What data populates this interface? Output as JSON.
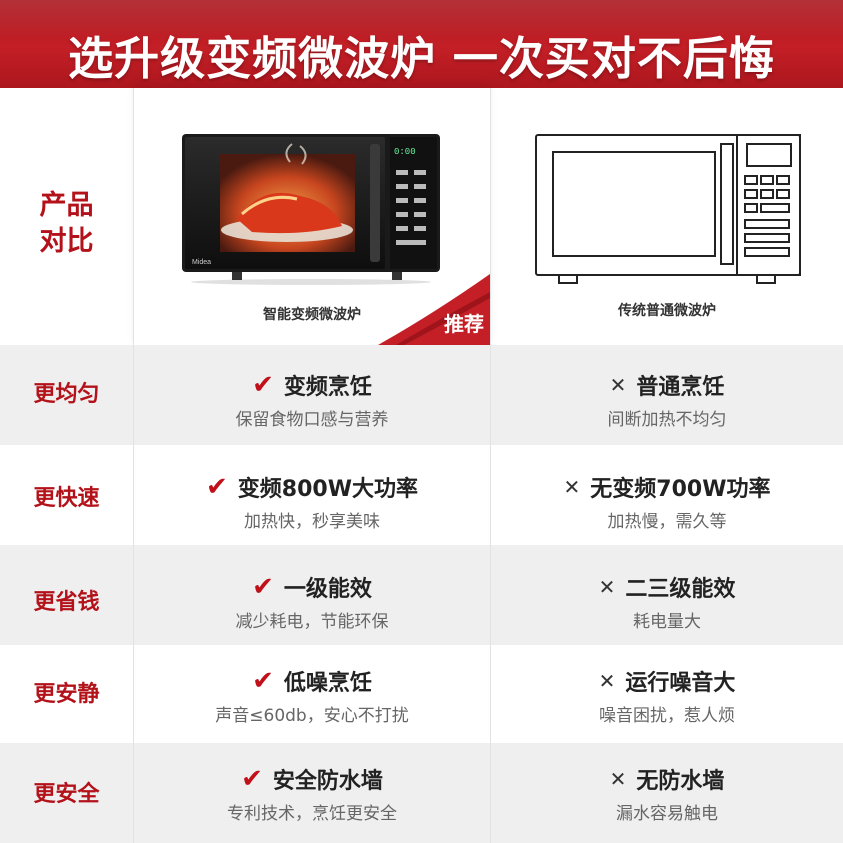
{
  "header": {
    "title": "选升级变频微波炉  一次买对不后悔"
  },
  "product_row": {
    "label_line1": "产品",
    "label_line2": "对比",
    "smart_caption": "智能变频微波炉",
    "plain_caption": "传统普通微波炉",
    "ribbon_text": "推荐",
    "smart_brand": "Midea",
    "smart_display": "0:00"
  },
  "rows": [
    {
      "label": "更均匀",
      "good_title": "变频烹饪",
      "good_sub": "保留食物口感与营养",
      "bad_title": "普通烹饪",
      "bad_sub": "间断加热不均匀"
    },
    {
      "label": "更快速",
      "good_title": "变频800W大功率",
      "good_sub": "加热快，秒享美味",
      "bad_title": "无变频700W功率",
      "bad_sub": "加热慢，需久等"
    },
    {
      "label": "更省钱",
      "good_title": "一级能效",
      "good_sub": "减少耗电，节能环保",
      "bad_title": "二三级能效",
      "bad_sub": "耗电量大"
    },
    {
      "label": "更安静",
      "good_title": "低噪烹饪",
      "good_sub": "声音≤60db，安心不打扰",
      "bad_title": "运行噪音大",
      "bad_sub": "噪音困扰，惹人烦"
    },
    {
      "label": "更安全",
      "good_title": "安全防水墙",
      "good_sub": "专利技术，烹饪更安全",
      "bad_title": "无防水墙",
      "bad_sub": "漏水容易触电"
    }
  ],
  "icons": {
    "good": "check-icon",
    "bad": "cross-icon"
  },
  "colors": {
    "brand_red": "#c41f26",
    "label_red": "#b3121a",
    "row_gray": "#efefef"
  }
}
